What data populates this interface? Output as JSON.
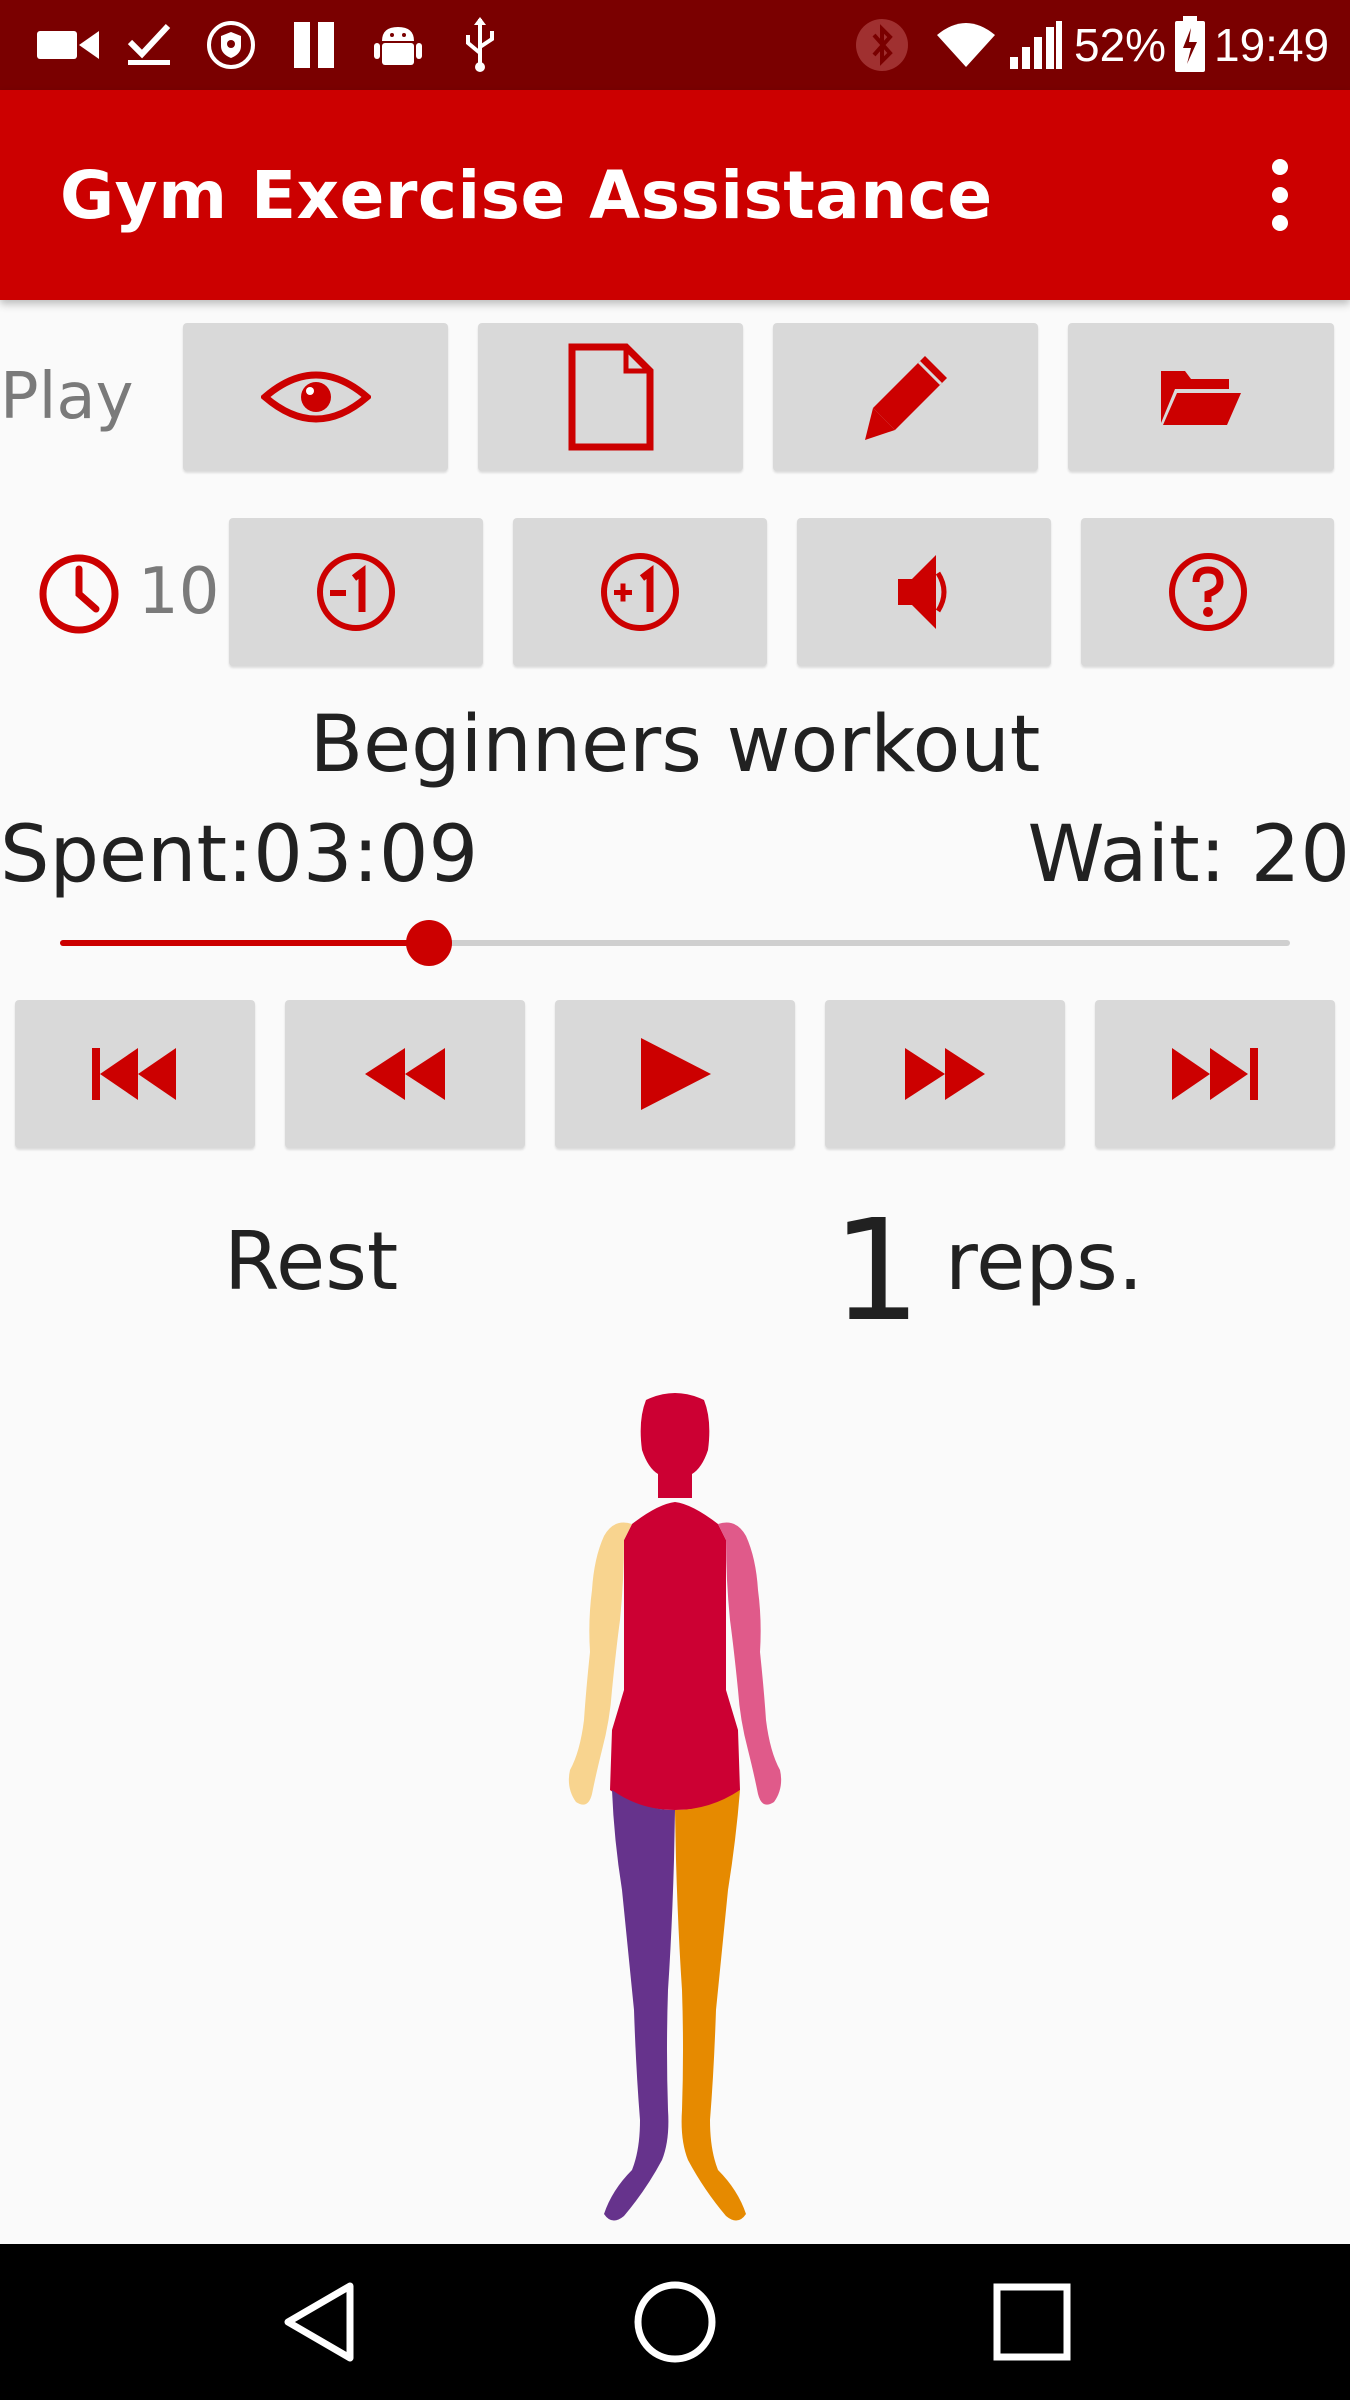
{
  "status_bar": {
    "icons": [
      "video-icon",
      "download-done-icon",
      "shield-icon",
      "pause-icon",
      "android-icon",
      "usb-icon",
      "bluetooth-icon",
      "wifi-icon",
      "signal-icon",
      "battery-icon"
    ],
    "battery_percent": "52%",
    "time": "19:49"
  },
  "app_bar": {
    "title": "Gym Exercise Assistance",
    "menu_icon": "more-vert-icon"
  },
  "row1": {
    "label": "Play",
    "buttons": [
      {
        "icon": "eye-icon",
        "name": "view"
      },
      {
        "icon": "new-file-icon",
        "name": "new"
      },
      {
        "icon": "pencil-icon",
        "name": "edit"
      },
      {
        "icon": "folder-open-icon",
        "name": "open"
      }
    ]
  },
  "row2": {
    "timer_icon": "clock-icon",
    "timer_value": "10",
    "buttons": [
      {
        "icon": "minus-one-icon",
        "name": "decrease"
      },
      {
        "icon": "plus-one-icon",
        "name": "increase"
      },
      {
        "icon": "speaker-icon",
        "name": "sound"
      },
      {
        "icon": "help-icon",
        "name": "help"
      }
    ]
  },
  "workout": {
    "name": "Beginners workout",
    "spent": "Spent:03:09",
    "wait": "Wait: 20",
    "progress": 0.3
  },
  "playback": {
    "buttons": [
      {
        "icon": "skip-to-start-icon",
        "name": "first"
      },
      {
        "icon": "rewind-icon",
        "name": "previous"
      },
      {
        "icon": "play-icon",
        "name": "play"
      },
      {
        "icon": "fast-forward-icon",
        "name": "next"
      },
      {
        "icon": "skip-to-end-icon",
        "name": "last"
      }
    ]
  },
  "exercise": {
    "name": "Rest",
    "reps_count": "1",
    "reps_label": "reps."
  },
  "colors": {
    "status_bar": "#7a0000",
    "app_bar": "#cc0000",
    "accent": "#cc0000",
    "button_bg": "#d9d9d9",
    "figure_torso": "#cc0033",
    "figure_left_arm": "#f8d48f",
    "figure_right_arm": "#e05a8a",
    "figure_left_leg": "#66338c",
    "figure_right_leg": "#e68a00"
  },
  "nav_bar": {
    "buttons": [
      "back-icon",
      "home-icon",
      "recents-icon"
    ]
  }
}
